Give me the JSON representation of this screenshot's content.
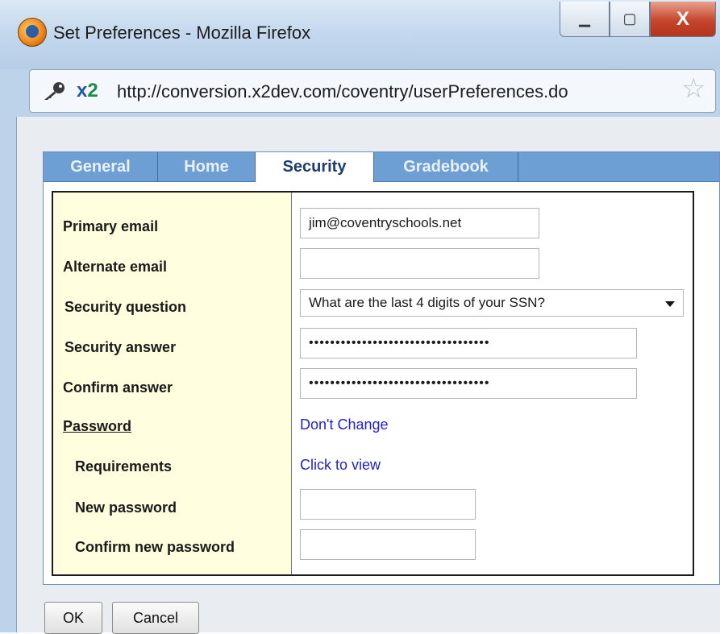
{
  "window": {
    "title": "Set Preferences - Mozilla Firefox",
    "minimize_glyph": "▁",
    "maximize_glyph": "▢",
    "close_glyph": "X"
  },
  "address_bar": {
    "badge_prefix": "x",
    "badge_suffix": "2",
    "url": "http://conversion.x2dev.com/coventry/userPreferences.do",
    "star_glyph": "☆"
  },
  "tabs": [
    {
      "label": "General",
      "active": false
    },
    {
      "label": "Home",
      "active": false
    },
    {
      "label": "Security",
      "active": true
    },
    {
      "label": "Gradebook",
      "active": false
    }
  ],
  "form": {
    "primary_email": {
      "label": "Primary email",
      "value": "jim@coventryschools.net"
    },
    "alternate_email": {
      "label": "Alternate email",
      "value": ""
    },
    "security_question": {
      "label": "Security question",
      "value": "What are the last 4 digits of your SSN?"
    },
    "security_answer": {
      "label": "Security answer",
      "value": "••••••••••••••••••••••••••••••••••"
    },
    "confirm_answer": {
      "label": "Confirm answer",
      "value": "••••••••••••••••••••••••••••••••••"
    },
    "password": {
      "label": "Password",
      "link": "Don't Change"
    },
    "requirements": {
      "label": "Requirements",
      "link": "Click to view"
    },
    "new_password": {
      "label": "New password",
      "value": ""
    },
    "confirm_new_password": {
      "label": "Confirm new password",
      "value": ""
    }
  },
  "buttons": {
    "ok": "OK",
    "cancel": "Cancel"
  },
  "colors": {
    "tab_bar": "#6d9fd4",
    "label_column": "#ffffe0",
    "link": "#2222cc"
  }
}
